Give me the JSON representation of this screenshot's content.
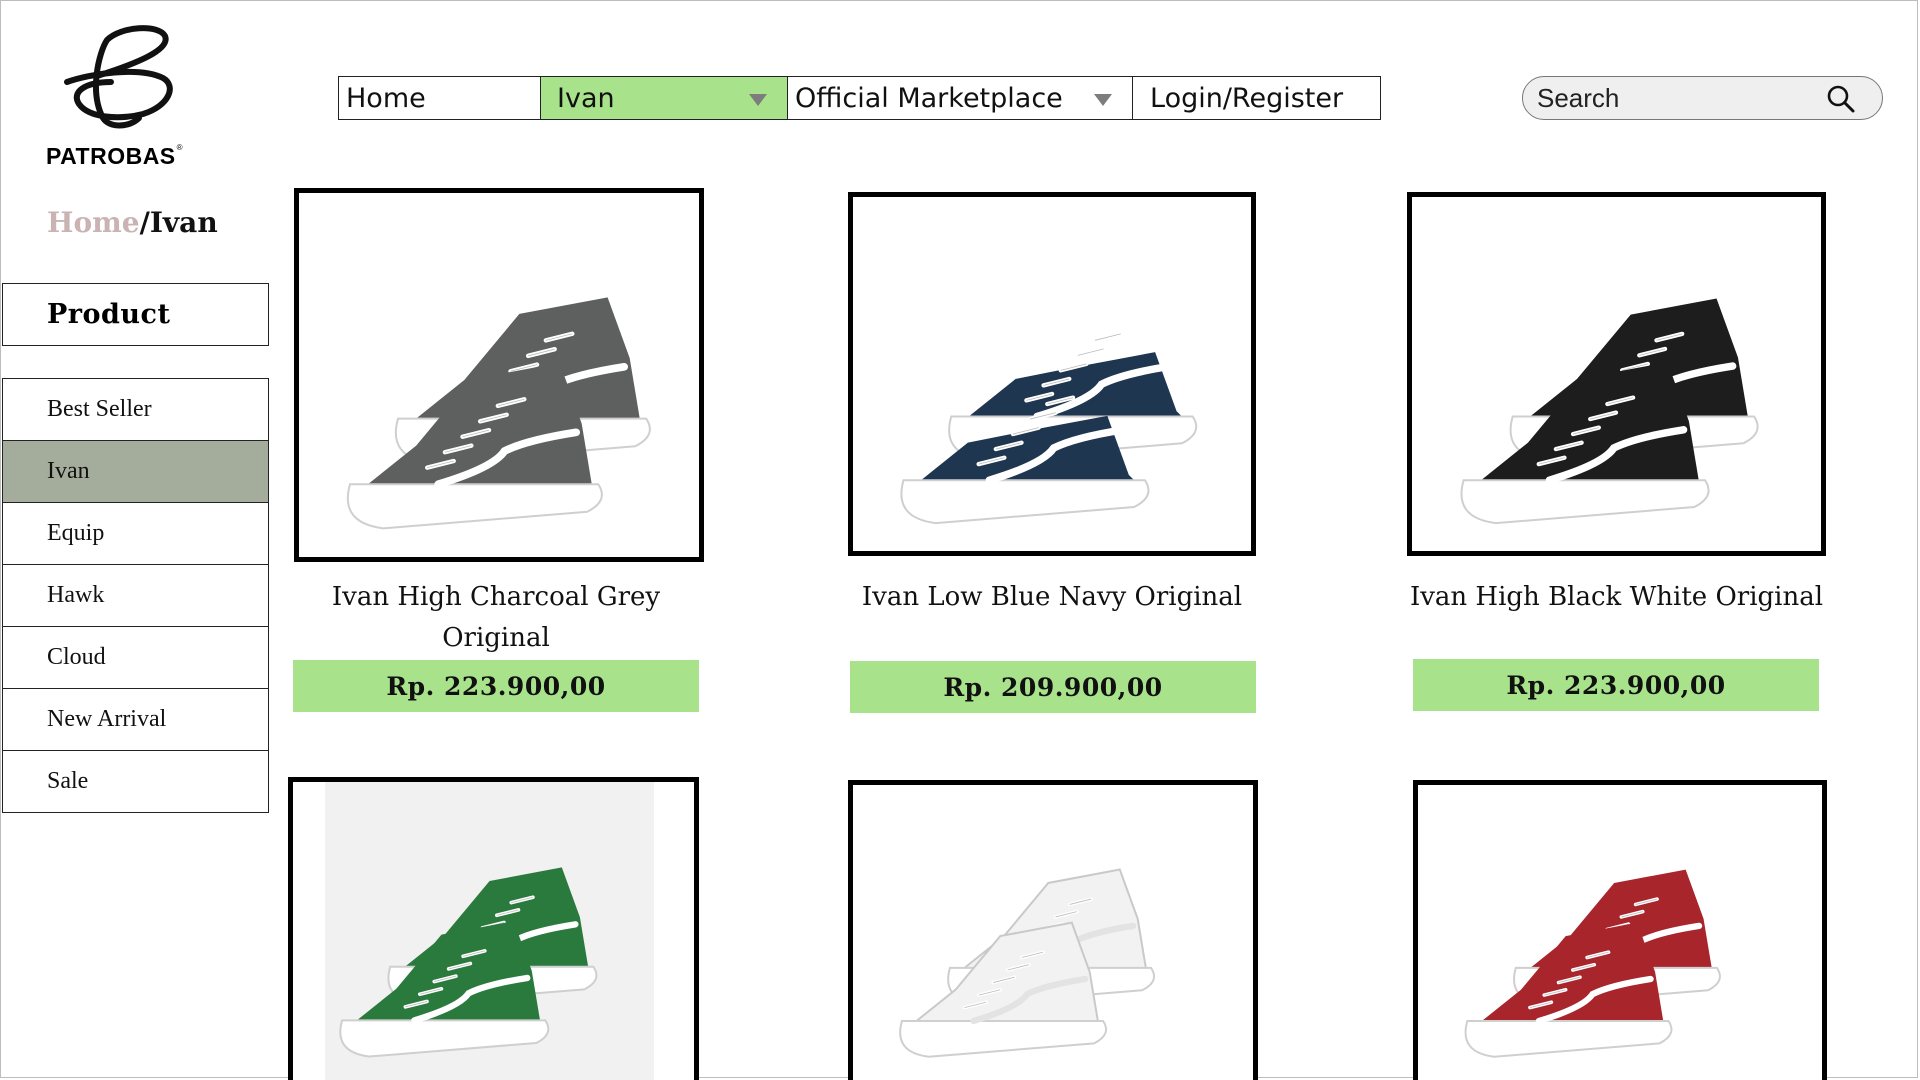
{
  "brand": {
    "name": "PATROBAS",
    "reg": "®"
  },
  "nav": {
    "home": "Home",
    "ivan": "Ivan",
    "marketplace": "Official Marketplace",
    "login": "Login/Register"
  },
  "search": {
    "placeholder": "Search"
  },
  "breadcrumb": {
    "home": "Home",
    "sep": "/",
    "current": "Ivan"
  },
  "sidebar": {
    "title": "Product",
    "items": [
      {
        "label": "Best Seller"
      },
      {
        "label": "Ivan"
      },
      {
        "label": "Equip"
      },
      {
        "label": "Hawk"
      },
      {
        "label": "Cloud"
      },
      {
        "label": "New Arrival"
      },
      {
        "label": "Sale"
      }
    ],
    "active": "Ivan"
  },
  "products": [
    {
      "name": "Ivan High Charcoal Grey Original",
      "price": "Rp. 223.900,00",
      "color": "#5e5f5f"
    },
    {
      "name": "Ivan Low Blue Navy Original",
      "price": "Rp. 209.900,00",
      "color": "#1f3650"
    },
    {
      "name": "Ivan High Black White Original",
      "price": "Rp. 223.900,00",
      "color": "#1d1d1d"
    },
    {
      "name": "",
      "price": "",
      "color": "#2b7a3d"
    },
    {
      "name": "",
      "price": "",
      "color": "#f2f2f2"
    },
    {
      "name": "",
      "price": "",
      "color": "#a8252c"
    }
  ],
  "colors": {
    "accent_green": "#a8e38c",
    "sidebar_active": "#a4ad9b",
    "crumb_muted": "#c9b3b3"
  },
  "icons": {
    "search": "search-icon",
    "dropdown": "caret-down-icon",
    "logo": "patrobas-logo-mark"
  }
}
